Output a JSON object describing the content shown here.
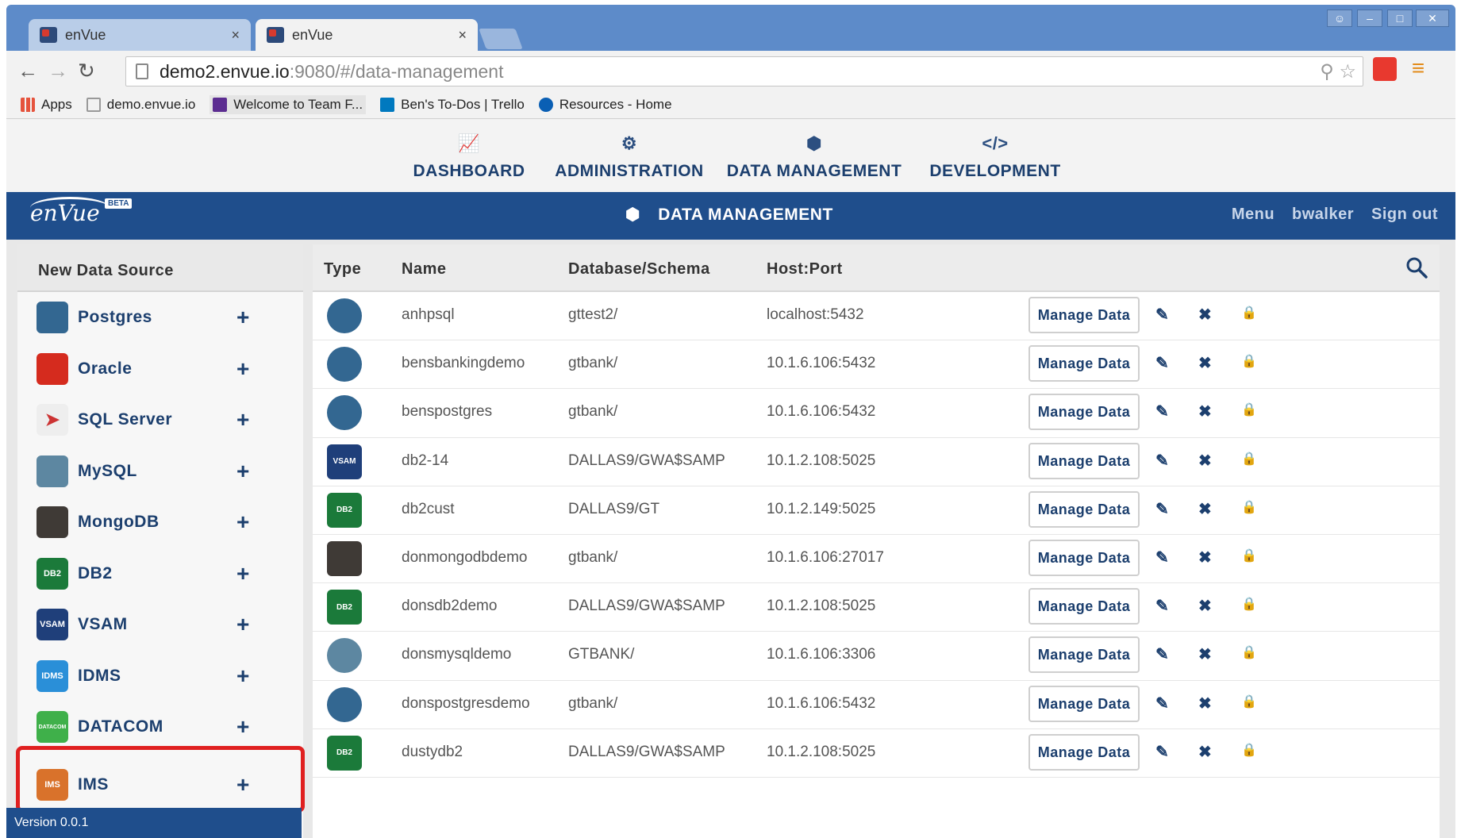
{
  "browser": {
    "tabs": [
      {
        "title": "enVue",
        "close": "×"
      },
      {
        "title": "enVue",
        "close": "×"
      }
    ],
    "url_host": "demo2.envue.io",
    "url_path": ":9080/#/data-management",
    "bookmarks": [
      "Apps",
      "demo.envue.io",
      "Welcome to Team F...",
      "Ben's To-Dos | Trello",
      "Resources - Home"
    ]
  },
  "topnav": [
    {
      "label": "DASHBOARD",
      "icon": "line-chart-icon"
    },
    {
      "label": "ADMINISTRATION",
      "icon": "cogs-icon"
    },
    {
      "label": "DATA MANAGEMENT",
      "icon": "cube-icon"
    },
    {
      "label": "DEVELOPMENT",
      "icon": "code-icon"
    }
  ],
  "appbar": {
    "logo": "enVue",
    "beta": "BETA",
    "title": "DATA MANAGEMENT",
    "menu": "Menu",
    "user": "bwalker",
    "signout": "Sign out"
  },
  "sidebar": {
    "header": "New Data Source",
    "add_symbol": "+",
    "items": [
      {
        "label": "Postgres",
        "icon": "postgres-icon",
        "color": "#336791"
      },
      {
        "label": "Oracle",
        "icon": "oracle-icon",
        "color": "#d52b1e"
      },
      {
        "label": "SQL Server",
        "icon": "sql-server-icon",
        "color": "#c8c8c8"
      },
      {
        "label": "MySQL",
        "icon": "mysql-icon",
        "color": "#5d87a1"
      },
      {
        "label": "MongoDB",
        "icon": "mongodb-icon",
        "color": "#3f3a36"
      },
      {
        "label": "DB2",
        "icon": "db2-icon",
        "color": "#1b7a3a",
        "badge": "DB2"
      },
      {
        "label": "VSAM",
        "icon": "vsam-icon",
        "color": "#1f3f7a",
        "badge": "VSAM"
      },
      {
        "label": "IDMS",
        "icon": "idms-icon",
        "color": "#2a8fd8",
        "badge": "IDMS"
      },
      {
        "label": "DATACOM",
        "icon": "datacom-icon",
        "color": "#3fb04a",
        "badge": "DATACOM"
      },
      {
        "label": "IMS",
        "icon": "ims-icon",
        "color": "#d9722b",
        "badge": "IMS"
      }
    ],
    "version": "Version 0.0.1"
  },
  "table": {
    "columns": [
      "Type",
      "Name",
      "Database/Schema",
      "Host:Port"
    ],
    "manage_label": "Manage Data",
    "rows": [
      {
        "type": "postgres",
        "name": "anhpsql",
        "schema": "gttest2/",
        "host": "localhost:5432"
      },
      {
        "type": "postgres",
        "name": "bensbankingdemo",
        "schema": "gtbank/",
        "host": "10.1.6.106:5432"
      },
      {
        "type": "postgres",
        "name": "benspostgres",
        "schema": "gtbank/",
        "host": "10.1.6.106:5432"
      },
      {
        "type": "vsam",
        "name": "db2-14",
        "schema": "DALLAS9/GWA$SAMP",
        "host": "10.1.2.108:5025"
      },
      {
        "type": "db2",
        "name": "db2cust",
        "schema": "DALLAS9/GT",
        "host": "10.1.2.149:5025"
      },
      {
        "type": "mongodb",
        "name": "donmongodbdemo",
        "schema": "gtbank/",
        "host": "10.1.6.106:27017"
      },
      {
        "type": "db2",
        "name": "donsdb2demo",
        "schema": "DALLAS9/GWA$SAMP",
        "host": "10.1.2.108:5025"
      },
      {
        "type": "mysql",
        "name": "donsmysqldemo",
        "schema": "GTBANK/",
        "host": "10.1.6.106:3306"
      },
      {
        "type": "postgres",
        "name": "donspostgresdemo",
        "schema": "gtbank/",
        "host": "10.1.6.106:5432"
      },
      {
        "type": "db2",
        "name": "dustydb2",
        "schema": "DALLAS9/GWA$SAMP",
        "host": "10.1.2.108:5025"
      }
    ]
  },
  "colors": {
    "brand": "#1f4e8c",
    "highlight": "#e02020"
  }
}
